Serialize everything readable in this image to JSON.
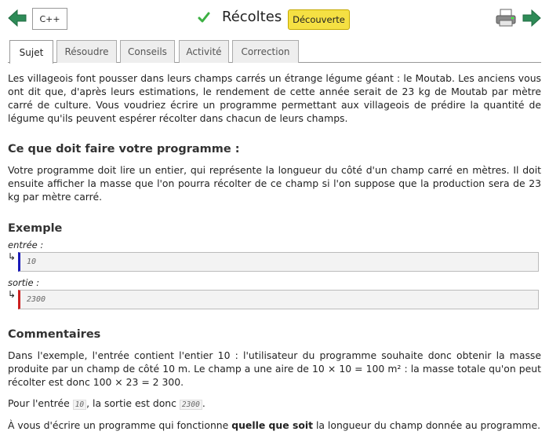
{
  "header": {
    "language": "C++",
    "title": "Récoltes",
    "badge": "Découverte"
  },
  "tabs": [
    {
      "label": "Sujet",
      "active": true
    },
    {
      "label": "Résoudre"
    },
    {
      "label": "Conseils"
    },
    {
      "label": "Activité"
    },
    {
      "label": "Correction"
    }
  ],
  "intro": "Les villageois font pousser dans leurs champs carrés un étrange légume géant : le Moutab. Les anciens vous ont dit que, d'après leurs estimations, le rendement de cette année serait de 23 kg de Moutab par mètre carré de culture. Vous voudriez écrire un programme permettant aux villageois de prédire la quantité de légume qu'ils peuvent espérer récolter dans chacun de leurs champs.",
  "task": {
    "heading": "Ce que doit faire votre programme :",
    "text": "Votre programme doit lire un entier, qui représente la longueur du côté d'un champ carré en mètres. Il doit ensuite afficher la masse que l'on pourra récolter de ce champ si l'on suppose que la production sera de 23 kg par mètre carré."
  },
  "example": {
    "heading": "Exemple",
    "input_label": "entrée :",
    "input_value": "10",
    "output_label": "sortie :",
    "output_value": "2300",
    "arrow": "↳"
  },
  "comments": {
    "heading": "Commentaires",
    "p1": "Dans l'exemple, l'entrée contient l'entier 10 : l'utilisateur du programme souhaite donc obtenir la masse produite par un champ de côté 10 m. Le champ a une aire de 10 × 10 = 100 m² : la masse totale qu'on peut récolter est donc 100 × 23 = 2 300.",
    "p2_before": "Pour l'entrée ",
    "p2_in": "10",
    "p2_mid": ", la sortie est donc ",
    "p2_out": "2300",
    "p2_after": ".",
    "p3_before": "À vous d'écrire un programme qui fonctionne ",
    "p3_bold": "quelle que soit",
    "p3_after": " la longueur du champ donnée au programme."
  },
  "colors": {
    "arrows": "#2e8b57",
    "check": "#3cb043",
    "badge": "#f5e043",
    "input_marker": "#1a1ab8",
    "output_marker": "#cc2020"
  },
  "icons": [
    "arrow-left-icon",
    "check-icon",
    "printer-icon",
    "arrow-right-icon"
  ]
}
